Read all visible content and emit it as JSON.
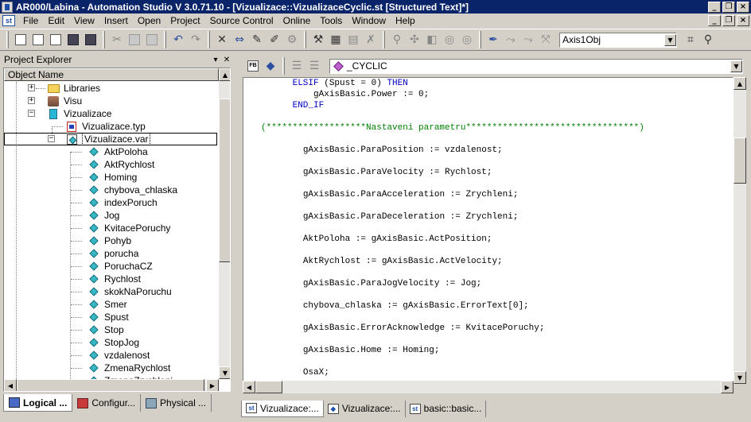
{
  "window": {
    "title": "AR000/Labina - Automation Studio V 3.0.71.10 - [Vizualizace::VizualizaceCyclic.st [Structured Text]*]"
  },
  "menu": {
    "items": [
      "File",
      "Edit",
      "View",
      "Insert",
      "Open",
      "Project",
      "Source Control",
      "Online",
      "Tools",
      "Window",
      "Help"
    ],
    "mdi_icon_text": "st"
  },
  "toolbar": {
    "axis_combo_value": "Axis1Obj"
  },
  "explorer": {
    "title": "Project Explorer",
    "column_header": "Object Name",
    "tree": {
      "libraries": "Libraries",
      "visu": "Visu",
      "vizualizace": "Vizualizace",
      "typ_file": "Vizualizace.typ",
      "var_file": "Vizualizace.var"
    },
    "variables": [
      "AktPoloha",
      "AktRychlost",
      "Homing",
      "chybova_chlaska",
      "indexPoruch",
      "Jog",
      "KvitacePoruchy",
      "Pohyb",
      "porucha",
      "PoruchaCZ",
      "Rychlost",
      "skokNaPoruchu",
      "Smer",
      "Spust",
      "Stop",
      "StopJog",
      "vzdalenost",
      "ZmenaRychlost",
      "ZmenaZrychleni"
    ],
    "tabs": [
      "Logical ...",
      "Configur...",
      "Physical ..."
    ]
  },
  "editor": {
    "combo_value": "_CYCLIC",
    "tabs": [
      "Vizualizace:...",
      "Vizualizace:...",
      "basic::basic..."
    ],
    "code_lines": [
      {
        "indent": "      ",
        "kw": "ELSIF",
        "text": " (Spust = 0) ",
        "kw2": "THEN",
        "text2": ""
      },
      {
        "indent": "          ",
        "text": "gAxisBasic.Power := 0;"
      },
      {
        "indent": "      ",
        "kw": "END_IF",
        "text": ""
      },
      {
        "text": ""
      },
      {
        "comment": "(*******************Nastaveni parametru*********************************)"
      },
      {
        "text": ""
      },
      {
        "indent": "        ",
        "text": "gAxisBasic.ParaPosition := vzdalenost;"
      },
      {
        "text": ""
      },
      {
        "indent": "        ",
        "text": "gAxisBasic.ParaVelocity := Rychlost;"
      },
      {
        "text": ""
      },
      {
        "indent": "        ",
        "text": "gAxisBasic.ParaAcceleration := Zrychleni;"
      },
      {
        "text": ""
      },
      {
        "indent": "        ",
        "text": "gAxisBasic.ParaDeceleration := Zrychleni;"
      },
      {
        "text": ""
      },
      {
        "indent": "        ",
        "text": "AktPoloha := gAxisBasic.ActPosition;"
      },
      {
        "text": ""
      },
      {
        "indent": "        ",
        "text": "AktRychlost := gAxisBasic.ActVelocity;"
      },
      {
        "text": ""
      },
      {
        "indent": "        ",
        "text": "gAxisBasic.ParaJogVelocity := Jog;"
      },
      {
        "text": ""
      },
      {
        "indent": "        ",
        "text": "chybova_chlaska := gAxisBasic.ErrorText[0];"
      },
      {
        "text": ""
      },
      {
        "indent": "        ",
        "text": "gAxisBasic.ErrorAcknowledge := KvitacePoruchy;"
      },
      {
        "text": ""
      },
      {
        "indent": "        ",
        "text": "gAxisBasic.Home := Homing;"
      },
      {
        "text": ""
      },
      {
        "indent": "        ",
        "text": "OsaX;"
      }
    ]
  }
}
